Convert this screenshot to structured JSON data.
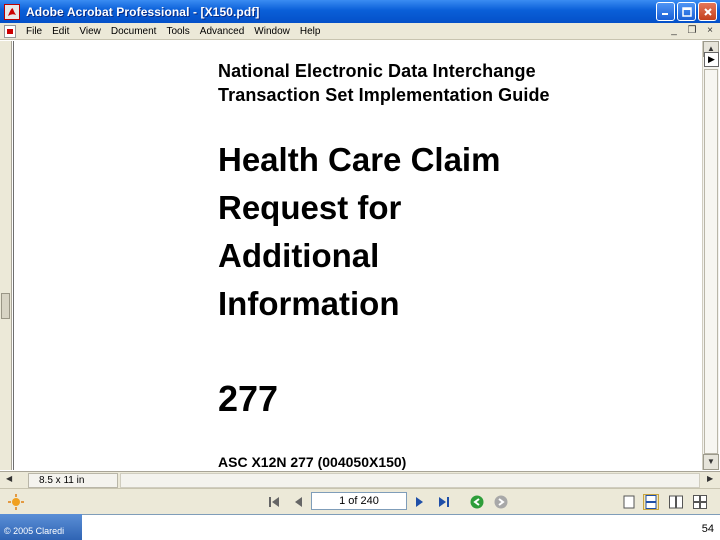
{
  "window": {
    "title": "Adobe Acrobat Professional - [X150.pdf]",
    "icons": {
      "app": "acrobat-app-icon",
      "minimize": "minimize-icon",
      "maximize": "maximize-icon",
      "close": "close-icon"
    }
  },
  "menu": {
    "items": [
      "File",
      "Edit",
      "View",
      "Document",
      "Tools",
      "Advanced",
      "Window",
      "Help"
    ],
    "mdi_controls": {
      "minimize": "_",
      "restore": "❐",
      "close": "×"
    }
  },
  "document": {
    "subtitle_line1": "National Electronic Data Interchange",
    "subtitle_line2": "Transaction Set Implementation Guide",
    "title_line1": "Health Care Claim",
    "title_line2": "Request for",
    "title_line3": "Additional",
    "title_line4": "Information",
    "transaction_number": "277",
    "asc_identifier": "ASC X12N 277 (004050X150)"
  },
  "status": {
    "page_size": "8.5 x 11 in"
  },
  "navigation": {
    "page_display": "1 of 240",
    "current_page": 1,
    "total_pages": 240,
    "icons": [
      "first-page-icon",
      "previous-page-icon",
      "next-page-icon",
      "last-page-icon",
      "previous-view-icon",
      "next-view-icon",
      "single-page-icon",
      "continuous-icon",
      "facing-icon",
      "continuous-facing-icon"
    ]
  },
  "footer": {
    "copyright": "© 2005 Claredi",
    "slide_number": "54"
  },
  "colors": {
    "titlebar_blue": "#0a5fd8",
    "chrome_beige": "#ece9d8",
    "footer_blue": "#2f64b4"
  }
}
